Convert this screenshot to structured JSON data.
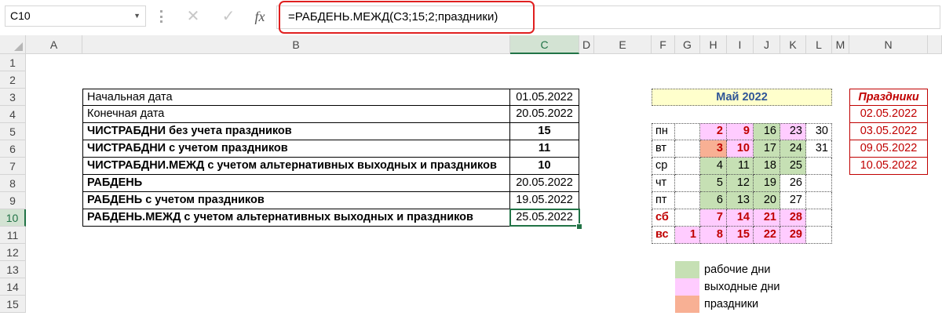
{
  "formula_bar": {
    "name_box": "C10",
    "cancel_icon": "✕",
    "enter_icon": "✓",
    "fx_label": "fx",
    "formula": "=РАБДЕНЬ.МЕЖД(C3;15;2;праздники)"
  },
  "columns": [
    "A",
    "B",
    "C",
    "D",
    "E",
    "F",
    "G",
    "H",
    "I",
    "J",
    "K",
    "L",
    "M",
    "N"
  ],
  "rows": [
    "1",
    "2",
    "3",
    "4",
    "5",
    "6",
    "7",
    "8",
    "9",
    "10",
    "11",
    "12",
    "13",
    "14",
    "15"
  ],
  "selected_cell": "C10",
  "main_table": [
    {
      "label": "Начальная дата",
      "value": "01.05.2022"
    },
    {
      "label": "Конечная дата",
      "value": "20.05.2022"
    },
    {
      "label": "ЧИСТРАБДНИ без учета праздников",
      "value": "15"
    },
    {
      "label": "ЧИСТРАБДНИ с учетом праздников",
      "value": "11"
    },
    {
      "label": "ЧИСТРАБДНИ.МЕЖД с учетом альтернативных выходных и праздников",
      "value": "10"
    },
    {
      "label": "РАБДЕНЬ",
      "value": "20.05.2022"
    },
    {
      "label": "РАБДЕНЬ с учетом праздников",
      "value": "19.05.2022"
    },
    {
      "label": "РАБДЕНЬ.МЕЖД с учетом альтернативных выходных и праздников",
      "value": "25.05.2022"
    }
  ],
  "calendar": {
    "title": "Май 2022",
    "days": [
      "пн",
      "вт",
      "ср",
      "чт",
      "пт",
      "сб",
      "вс"
    ],
    "weeks": [
      [
        "",
        "",
        "",
        "",
        "",
        "",
        "1"
      ],
      [
        "2",
        "3",
        "4",
        "5",
        "6",
        "7",
        "8"
      ],
      [
        "9",
        "10",
        "11",
        "12",
        "13",
        "14",
        "15"
      ],
      [
        "16",
        "17",
        "18",
        "19",
        "20",
        "21",
        "22"
      ],
      [
        "23",
        "24",
        "25",
        "26",
        "27",
        "28",
        "29"
      ],
      [
        "30",
        "31",
        "",
        "",
        "",
        "",
        ""
      ]
    ]
  },
  "holidays": {
    "title": "Праздники",
    "dates": [
      "02.05.2022",
      "03.05.2022",
      "09.05.2022",
      "10.05.2022"
    ]
  },
  "legend": [
    {
      "label": "рабочие дни",
      "color": "#c6e0b4"
    },
    {
      "label": "выходные дни",
      "color": "#ffccff"
    },
    {
      "label": "праздники",
      "color": "#f8b094"
    }
  ],
  "colors": {
    "selection": "#217346",
    "formula_highlight": "#e02020",
    "calendar_title": "#2f5597",
    "holiday_text": "#c00000"
  }
}
